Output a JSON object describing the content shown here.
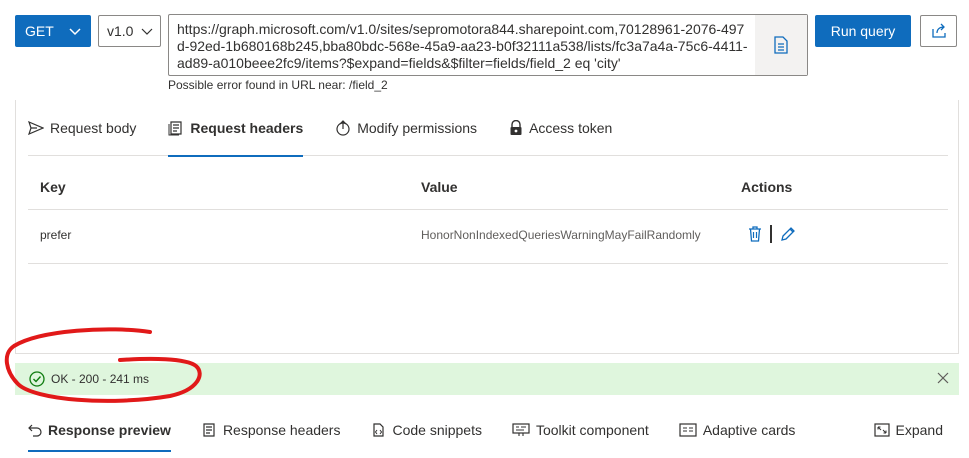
{
  "query_bar": {
    "method": "GET",
    "version": "v1.0",
    "url": "https://graph.microsoft.com/v1.0/sites/sepromotora844.sharepoint.com,70128961-2076-497d-92ed-1b680168b245,bba80bdc-568e-45a9-aa23-b0f32111a538/lists/fc3a7a4a-75c6-4411-ad89-a010beee2fc9/items?$expand=fields&$filter=fields/field_2 eq 'city'",
    "error_hint": "Possible error found in URL near: /field_2",
    "run_label": "Run query"
  },
  "request_tabs": [
    {
      "label": "Request body",
      "icon": "send-icon"
    },
    {
      "label": "Request headers",
      "icon": "headers-icon",
      "active": true
    },
    {
      "label": "Modify permissions",
      "icon": "permissions-icon"
    },
    {
      "label": "Access token",
      "icon": "lock-icon"
    }
  ],
  "headers_table": {
    "columns": {
      "key": "Key",
      "value": "Value",
      "actions": "Actions"
    },
    "rows": [
      {
        "key": "prefer",
        "value": "HonorNonIndexedQueriesWarningMayFailRandomly"
      }
    ]
  },
  "status": {
    "text": "OK - 200 - 241 ms",
    "color": "#dff6dd"
  },
  "response_tabs": [
    {
      "label": "Response preview",
      "icon": "undo-icon",
      "active": true
    },
    {
      "label": "Response headers",
      "icon": "document-icon"
    },
    {
      "label": "Code snippets",
      "icon": "code-icon"
    },
    {
      "label": "Toolkit component",
      "icon": "toolkit-icon"
    },
    {
      "label": "Adaptive cards",
      "icon": "card-icon"
    }
  ],
  "expand_label": "Expand",
  "colors": {
    "accent": "#0f6cbd",
    "annotation": "#e11919",
    "success_bg": "#dff6dd",
    "success_icon": "#107c10"
  }
}
